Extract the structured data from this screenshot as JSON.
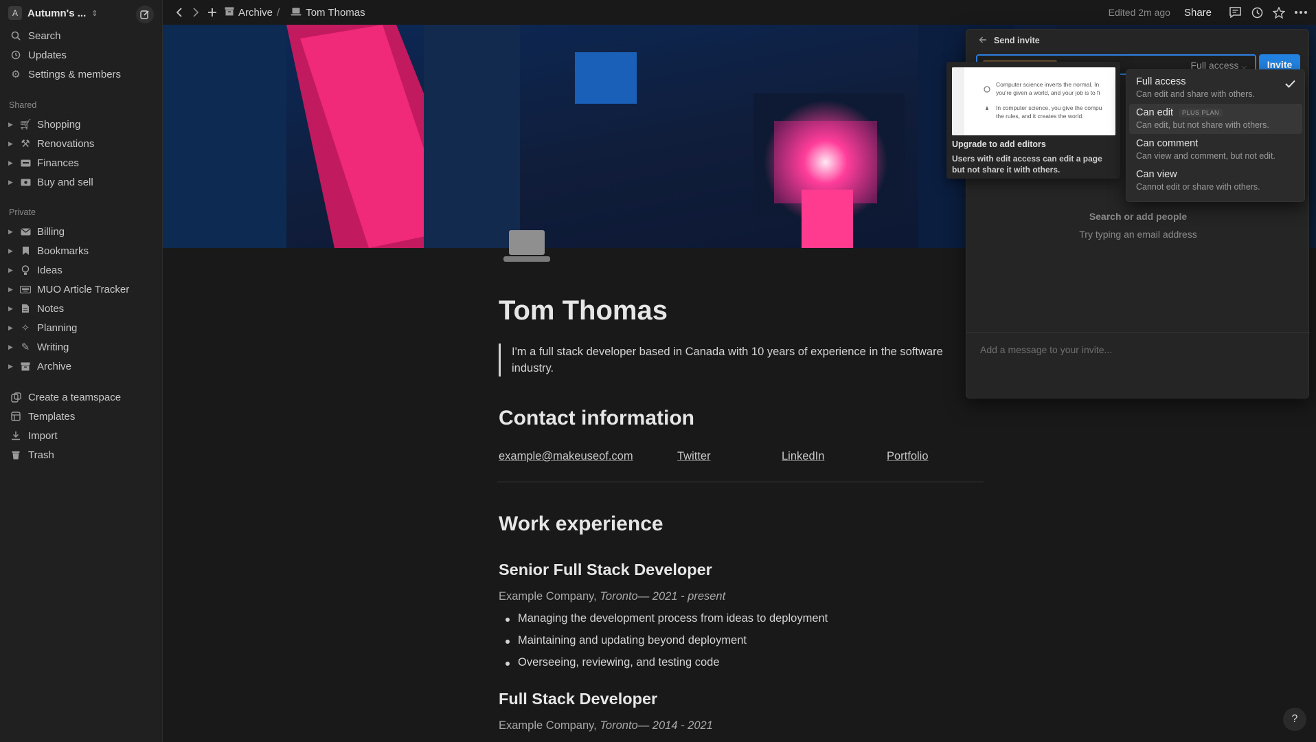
{
  "workspace": {
    "initial": "A",
    "name": "Autumn's ..."
  },
  "sidebar": {
    "top_items": [
      {
        "label": "Search",
        "icon": "search-icon"
      },
      {
        "label": "Updates",
        "icon": "clock-icon"
      },
      {
        "label": "Settings & members",
        "icon": "gear-icon"
      }
    ],
    "shared_label": "Shared",
    "shared_items": [
      {
        "label": "Shopping",
        "icon": "cart-icon"
      },
      {
        "label": "Renovations",
        "icon": "hammer-icon"
      },
      {
        "label": "Finances",
        "icon": "money-icon"
      },
      {
        "label": "Buy and sell",
        "icon": "cash-icon"
      }
    ],
    "private_label": "Private",
    "private_items": [
      {
        "label": "Billing",
        "icon": "envelope-icon"
      },
      {
        "label": "Bookmarks",
        "icon": "bookmark-icon"
      },
      {
        "label": "Ideas",
        "icon": "lightbulb-icon"
      },
      {
        "label": "MUO Article Tracker",
        "icon": "keyboard-icon"
      },
      {
        "label": "Notes",
        "icon": "document-icon"
      },
      {
        "label": "Planning",
        "icon": "sparkle-icon"
      },
      {
        "label": "Writing",
        "icon": "pencil-icon"
      },
      {
        "label": "Archive",
        "icon": "archive-icon"
      }
    ],
    "bottom_items": [
      {
        "label": "Create a teamspace",
        "icon": "teamspace-icon"
      },
      {
        "label": "Templates",
        "icon": "templates-icon"
      },
      {
        "label": "Import",
        "icon": "import-icon"
      },
      {
        "label": "Trash",
        "icon": "trash-icon"
      }
    ]
  },
  "topbar": {
    "breadcrumb": [
      {
        "label": "Archive",
        "sep": "/"
      },
      {
        "label": "Tom Thomas",
        "sep": ""
      }
    ],
    "edited": "Edited 2m ago",
    "share": "Share"
  },
  "page": {
    "title": "Tom Thomas",
    "quote": "I'm a full stack developer based in Canada with 10 years of experience in the software industry.",
    "contact_heading": "Contact information",
    "contact_links": [
      "example@makeuseof.com",
      "Twitter",
      "LinkedIn",
      "Portfolio"
    ],
    "work_heading": "Work experience",
    "jobs": [
      {
        "title": "Senior Full Stack Developer",
        "company": "Example Company,",
        "location_dates": "Toronto— 2021 - present",
        "bullets": [
          "Managing the development process from ideas to deployment",
          "Maintaining and updating beyond deployment",
          "Overseeing, reviewing, and testing code"
        ]
      },
      {
        "title": "Full Stack Developer",
        "company": "Example Company,",
        "location_dates": "Toronto— 2014 - 2021"
      }
    ]
  },
  "share_panel": {
    "header": "Send invite",
    "access_selected": "Full access",
    "invite": "Invite",
    "empty_title": "Search or add people",
    "empty_sub": "Try typing an email address",
    "message_placeholder": "Add a message to your invite..."
  },
  "upgrade_tip": {
    "preview_lines": [
      "Computer science inverts the normal. In",
      "you're given a world, and your job is to fi",
      "In computer science, you give the compu",
      "the rules, and it creates the world."
    ],
    "title": "Upgrade to add editors",
    "body": "Users with edit access can edit a page but not share it with others."
  },
  "access_menu": {
    "options": [
      {
        "label": "Full access",
        "desc": "Can edit and share with others.",
        "checked": true,
        "badge": ""
      },
      {
        "label": "Can edit",
        "desc": "Can edit, but not share with others.",
        "checked": false,
        "badge": "PLUS PLAN"
      },
      {
        "label": "Can comment",
        "desc": "Can view and comment, but not edit.",
        "checked": false,
        "badge": ""
      },
      {
        "label": "Can view",
        "desc": "Cannot edit or share with others.",
        "checked": false,
        "badge": ""
      }
    ]
  },
  "help": "?",
  "colors": {
    "accent": "#2383e2",
    "background": "#191919",
    "sidebar": "#202020"
  }
}
